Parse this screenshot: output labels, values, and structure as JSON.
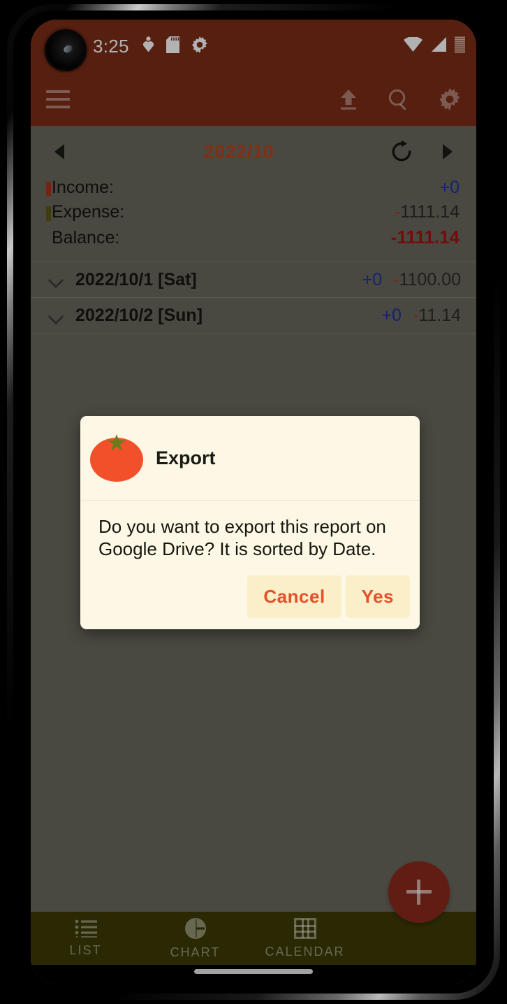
{
  "status_bar": {
    "time": "3:25",
    "left_icons": [
      "heartbeat-icon",
      "sd-card-icon",
      "gear-icon"
    ],
    "right_icons": [
      "wifi-icon",
      "cellular-signal-icon",
      "battery-icon"
    ]
  },
  "app_bar": {
    "menu_icon": "hamburger-menu-icon",
    "actions": [
      {
        "name": "export-upload-icon",
        "label": "Export"
      },
      {
        "name": "search-icon",
        "label": "Search"
      },
      {
        "name": "settings-gear-icon",
        "label": "Settings"
      }
    ]
  },
  "month_bar": {
    "prev_label": "◀",
    "month": "2022/10",
    "refresh_label": "Refresh",
    "next_label": "▶"
  },
  "summary": {
    "income": {
      "label": "Income:",
      "sign": "+",
      "value": "0"
    },
    "expense": {
      "label": "Expense:",
      "sign": "-",
      "value": "1111.14"
    },
    "balance": {
      "label": "Balance:",
      "sign": "-",
      "value": "1111.14"
    }
  },
  "days": [
    {
      "date": "2022/10/1 [Sat]",
      "income_sign": "+",
      "income": "0",
      "expense_sign": "-",
      "expense": "1100.00"
    },
    {
      "date": "2022/10/2 [Sun]",
      "income_sign": "+",
      "income": "0",
      "expense_sign": "-",
      "expense": "11.14"
    }
  ],
  "fab": {
    "label": "+",
    "icon": "plus-icon"
  },
  "bottom_nav": [
    {
      "icon": "list-icon",
      "label": "LIST"
    },
    {
      "icon": "pie-chart-icon",
      "label": "CHART"
    },
    {
      "icon": "calendar-grid-icon",
      "label": "CALENDAR"
    }
  ],
  "dialog": {
    "icon": "tomato-icon",
    "title": "Export",
    "message": "Do you want to export this report on Google Drive? It is sorted by Date.",
    "cancel_label": "Cancel",
    "confirm_label": "Yes"
  },
  "colors": {
    "app_bar": "#7b2d18",
    "content_bg": "#6b695e",
    "bottom_nav": "#3e3c06",
    "accent_month": "#b9441f",
    "positive": "#1d2fa8",
    "negative": "#b7301f",
    "balance": "#a31414",
    "dialog_bg": "#fdf8e6",
    "dialog_button_bg": "#faefc8",
    "dialog_button_text": "#e4502b",
    "fab": "#8c2a1c",
    "tomato_body": "#f2502a",
    "tomato_stem": "#6f7a1c"
  }
}
